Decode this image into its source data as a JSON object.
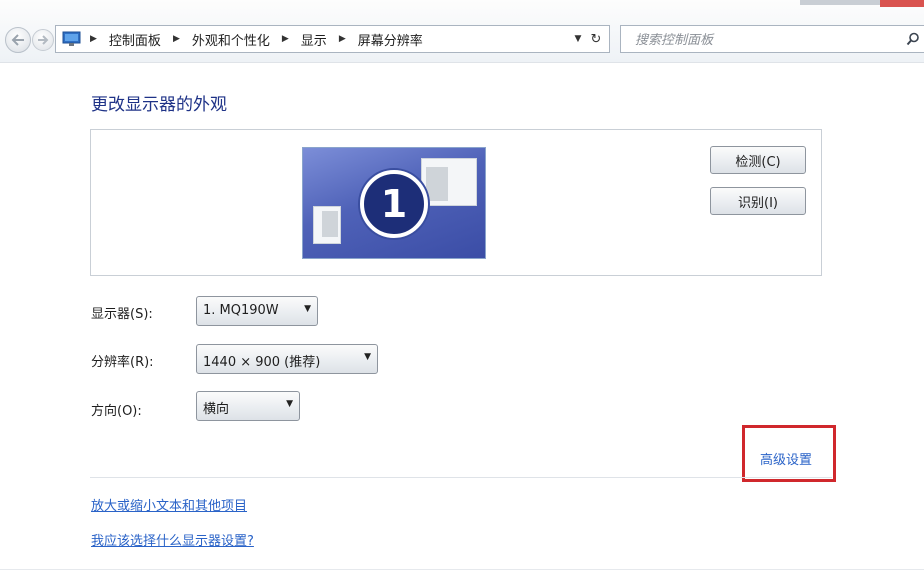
{
  "window": {
    "search_placeholder": "搜索控制面板",
    "breadcrumb": [
      "控制面板",
      "外观和个性化",
      "显示",
      "屏幕分辨率"
    ]
  },
  "icons": {
    "back": "back-arrow-icon",
    "forward": "forward-arrow-icon",
    "control_panel": "control-panel-icon",
    "breadcrumb_separator": "chevron-right-icon",
    "address_dropdown": "chevron-down-icon",
    "refresh": "refresh-icon",
    "search": "search-icon"
  },
  "page": {
    "title": "更改显示器的外观"
  },
  "preview": {
    "monitor_number": "1",
    "detect_label": "检测(C)",
    "identify_label": "识别(I)"
  },
  "settings": {
    "display_label": "显示器(S):",
    "display_value": "1. MQ190W",
    "resolution_label": "分辨率(R):",
    "resolution_value": "1440 × 900 (推荐)",
    "orientation_label": "方向(O):",
    "orientation_value": "横向"
  },
  "links": {
    "advanced": "高级设置",
    "text_size": "放大或缩小文本和其他项目",
    "help": "我应该选择什么显示器设置?"
  },
  "colors": {
    "title_blue": "#1e3287",
    "link_blue": "#2a63c8",
    "highlight_red": "#d0282c",
    "monitor_blue": "#4f62b8"
  }
}
